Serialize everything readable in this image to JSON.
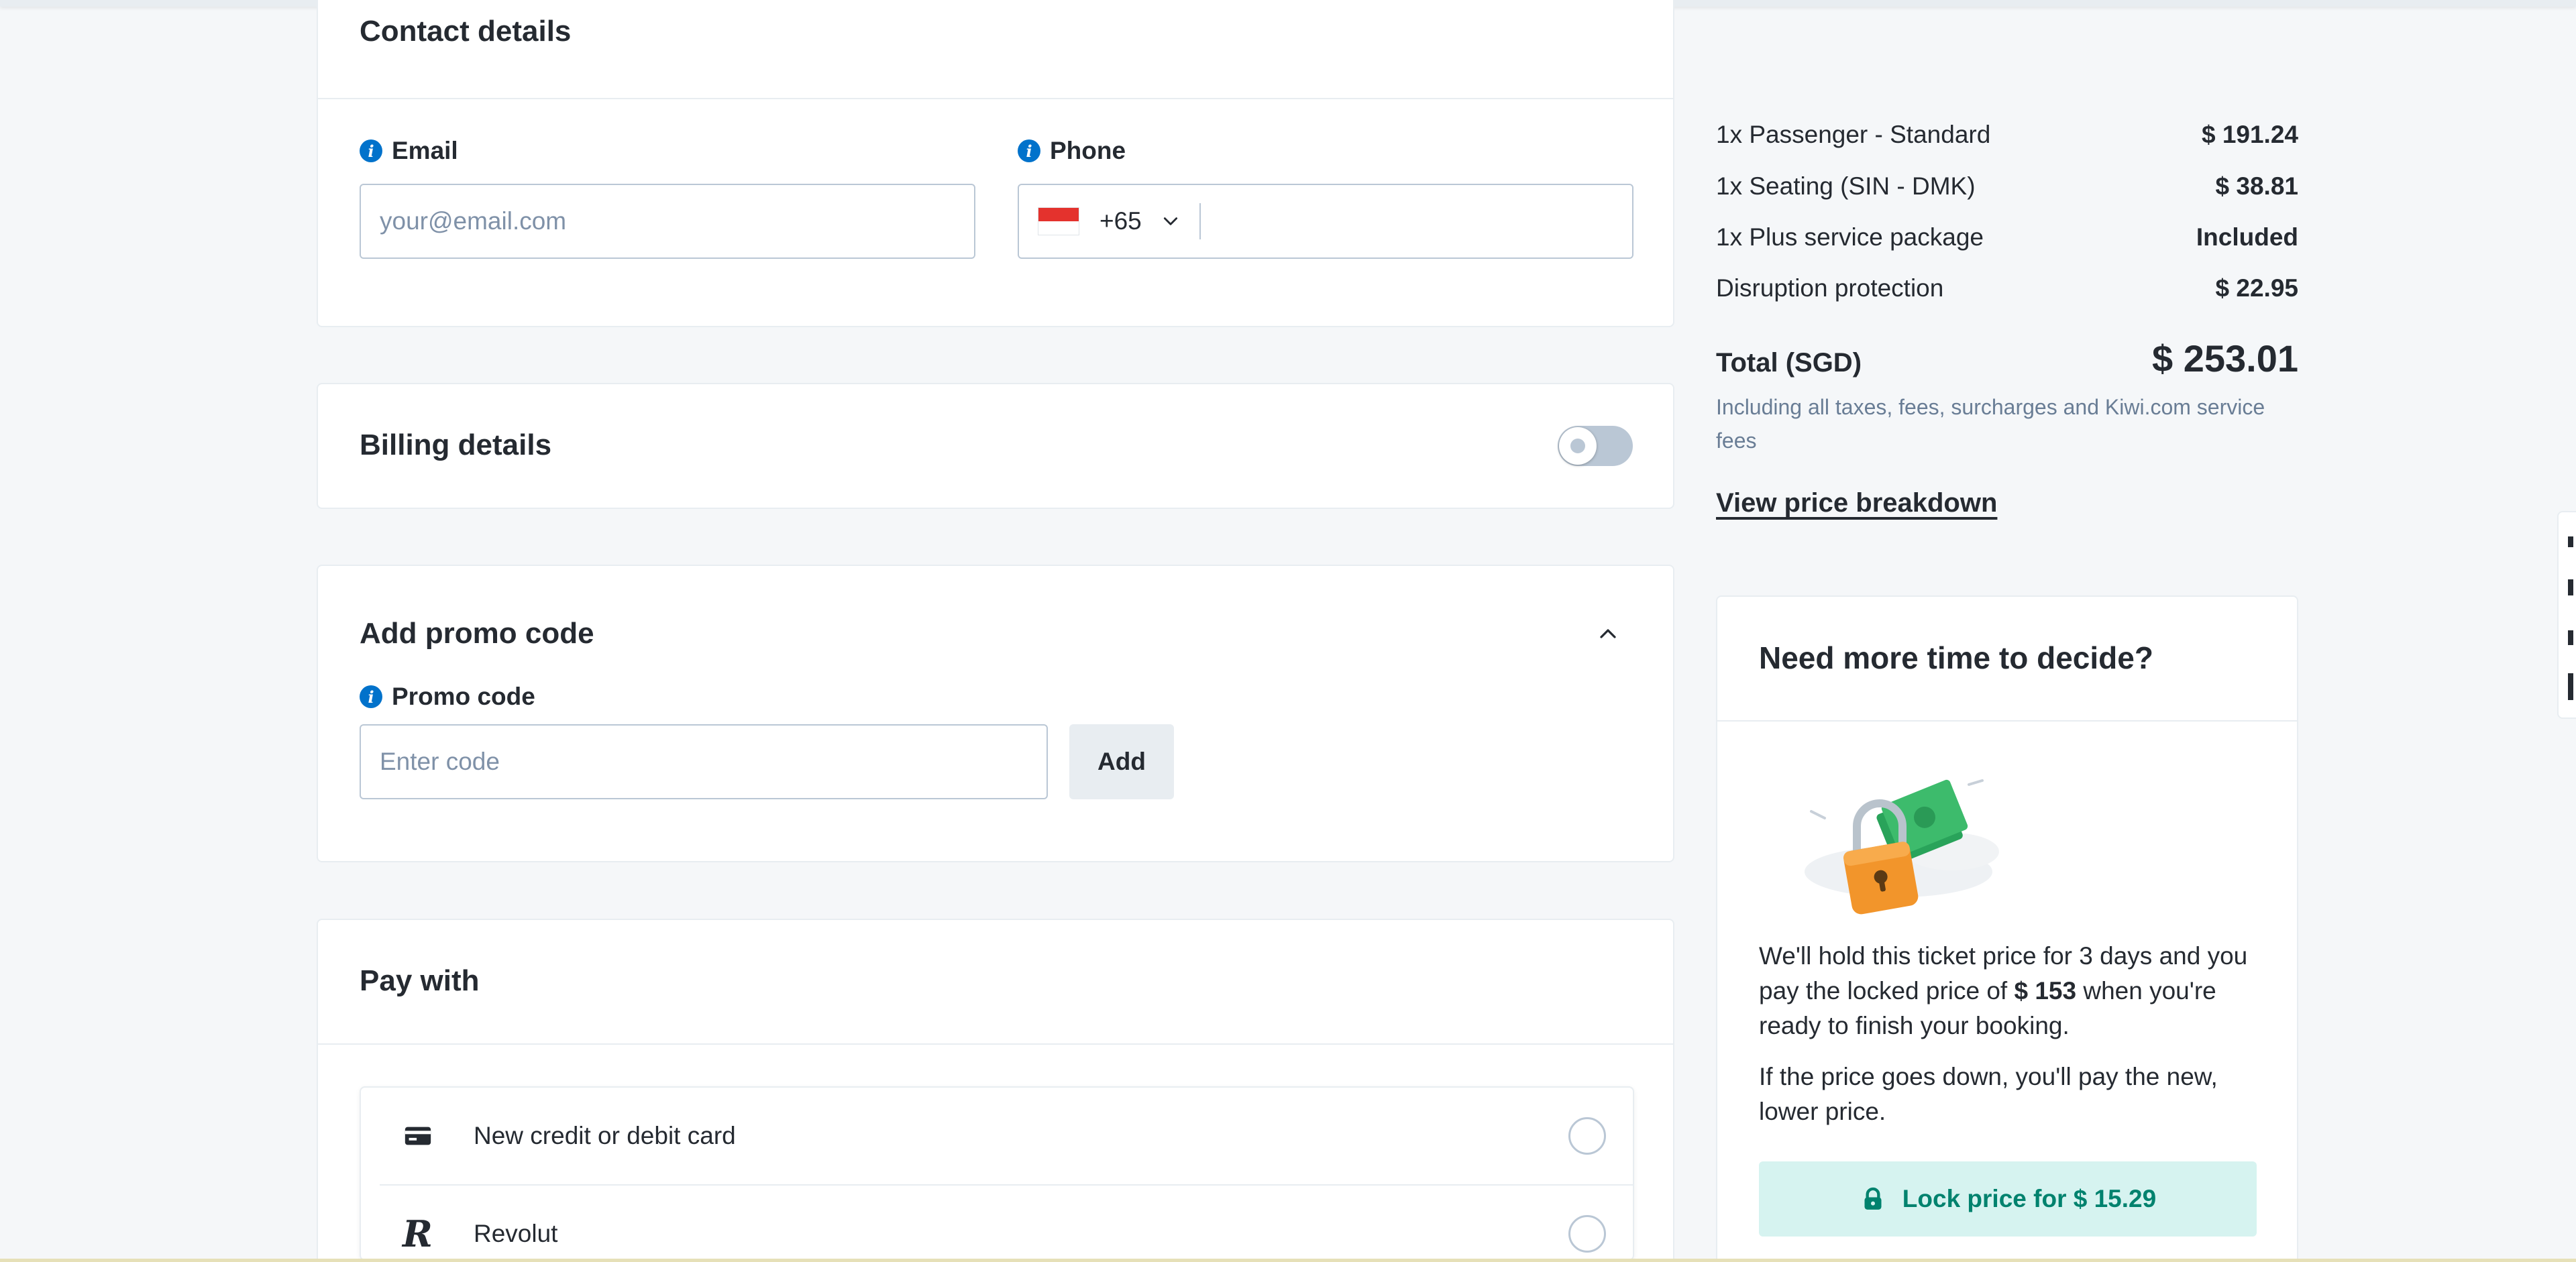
{
  "contact": {
    "title": "Contact details",
    "email_label": "Email",
    "email_placeholder": "your@email.com",
    "phone_label": "Phone",
    "dial_code": "+65",
    "phone_value": ""
  },
  "billing": {
    "title": "Billing details",
    "toggle_on": false
  },
  "promo": {
    "title": "Add promo code",
    "label": "Promo code",
    "placeholder": "Enter code",
    "add_label": "Add"
  },
  "pay": {
    "title": "Pay with",
    "options": [
      {
        "label": "New credit or debit card",
        "icon": "credit-card-icon"
      },
      {
        "label": "Revolut",
        "icon": "revolut-icon"
      }
    ]
  },
  "summary": {
    "items": [
      {
        "label": "1x Passenger - Standard",
        "value": "$ 191.24"
      },
      {
        "label": "1x Seating (SIN - DMK)",
        "value": "$ 38.81"
      },
      {
        "label": "1x Plus service package",
        "value": "Included"
      },
      {
        "label": "Disruption protection",
        "value": "$ 22.95"
      }
    ],
    "total_label": "Total (SGD)",
    "total_value": "$ 253.01",
    "tax_note": "Including all taxes, fees, surcharges and Kiwi.com service fees",
    "breakdown_link": "View price breakdown"
  },
  "lock": {
    "title": "Need more time to decide?",
    "p1_pre": "We'll hold this ticket price for 3 days and you pay the locked price of ",
    "p1_bold": "$ 153",
    "p1_post": " when you're ready to finish your booking.",
    "p2": "If the price goes down, you'll pay the new, lower price.",
    "button": "Lock price for $ 15.29"
  },
  "colors": {
    "info_blue": "#0172cb",
    "lock_green": "#00826e",
    "lock_bg": "#d6f3f0",
    "border": "#bac7d5"
  }
}
